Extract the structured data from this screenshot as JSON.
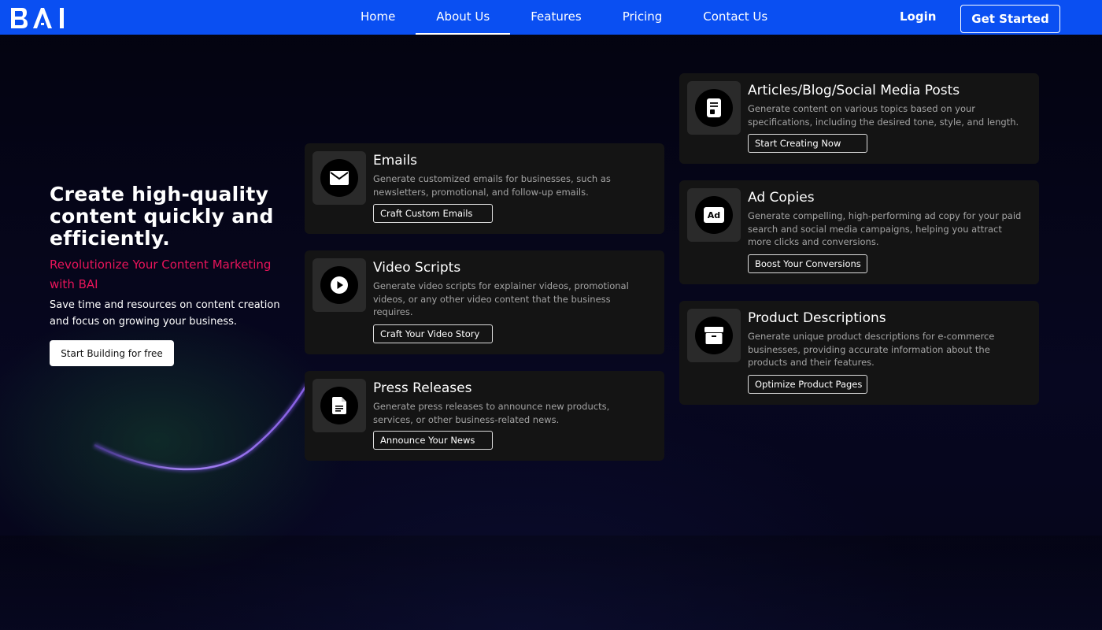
{
  "brand": {
    "logo_text": "BAI"
  },
  "nav": {
    "links": [
      "Home",
      "About Us",
      "Features",
      "Pricing",
      "Contact Us"
    ],
    "active": "About Us",
    "login_label": "Login",
    "cta_label": "Get Started"
  },
  "hero": {
    "title": "Create high-quality content quickly and efficiently.",
    "subtitle": "Revolutionize Your Content Marketing with BAI",
    "description": "Save time and resources on content creation and focus on growing your business.",
    "cta_label": "Start Building for free"
  },
  "cards": [
    {
      "title": "Emails",
      "description": "Generate customized emails for businesses, such as newsletters, promotional, and follow-up emails.",
      "button": "Craft Custom Emails",
      "icon": "envelope-icon"
    },
    {
      "title": "Video Scripts",
      "description": "Generate video scripts for explainer videos, promotional videos, or any other video content that the business requires.",
      "button": "Craft Your Video Story",
      "icon": "play-icon"
    },
    {
      "title": "Press Releases",
      "description": "Generate press releases to announce new products, services, or other business-related news.",
      "button": "Announce Your News",
      "icon": "document-icon"
    },
    {
      "title": "Articles/Blog/Social Media Posts",
      "description": "Generate content on various topics based on your specifications, including the desired tone, style, and length.",
      "button": "Start Creating Now",
      "icon": "article-icon"
    },
    {
      "title": "Ad Copies",
      "description": "Generate compelling, high-performing ad copy for your paid search and social media campaigns, helping you attract more clicks and conversions.",
      "button": "Boost Your Conversions",
      "icon": "ad-icon",
      "icon_text": "Ad"
    },
    {
      "title": "Product Descriptions",
      "description": "Generate unique product descriptions for e-commerce businesses, providing accurate information about the products and their features.",
      "button": "Optimize Product Pages",
      "icon": "box-icon"
    }
  ],
  "colors": {
    "nav_bg": "#0a4ff2",
    "accent": "#e8145a",
    "page_bg": "#050516",
    "card_bg": "#141414"
  }
}
